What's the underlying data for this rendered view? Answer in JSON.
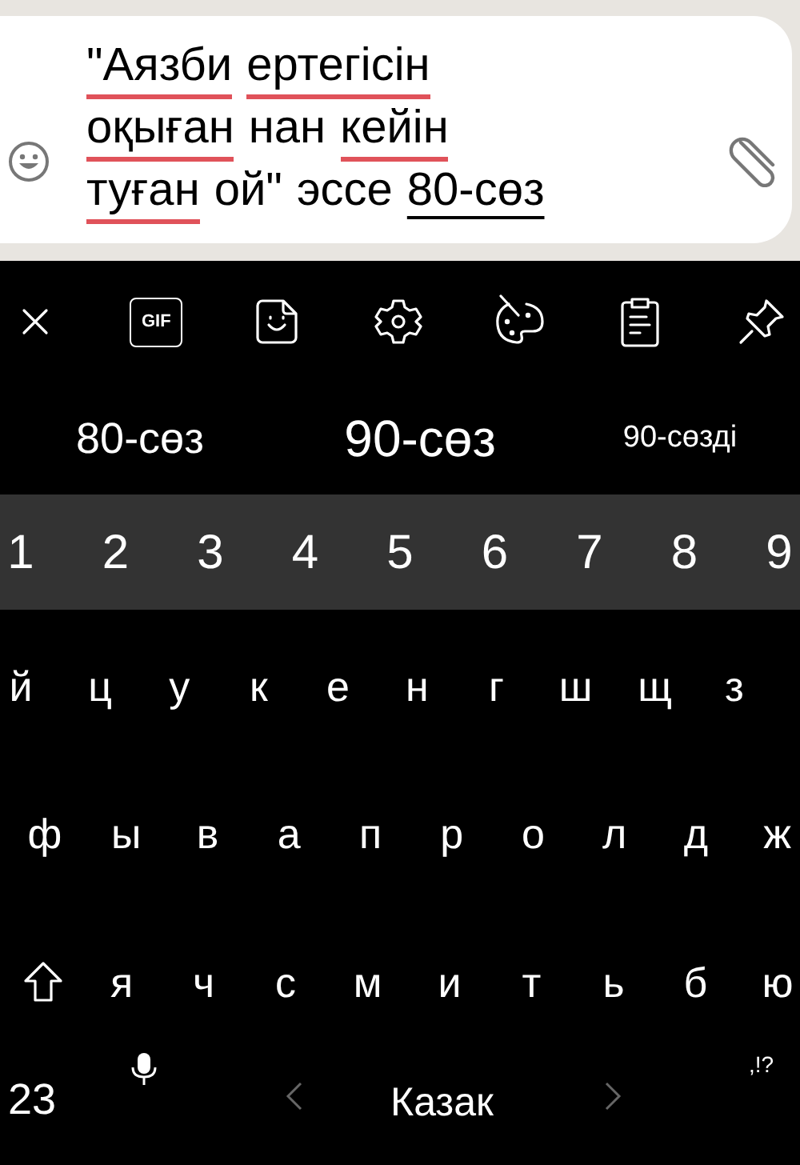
{
  "message": {
    "lines": [
      [
        {
          "text": "\"Аязби",
          "misspelled": true,
          "composing": false
        },
        {
          "text": "ертегісін",
          "misspelled": true,
          "composing": false
        }
      ],
      [
        {
          "text": "оқыған",
          "misspelled": true,
          "composing": false
        },
        {
          "text": "нан",
          "misspelled": false,
          "composing": false
        },
        {
          "text": "кейін",
          "misspelled": true,
          "composing": false
        }
      ],
      [
        {
          "text": "туған",
          "misspelled": true,
          "composing": false
        },
        {
          "text": "ой\"",
          "misspelled": false,
          "composing": false
        },
        {
          "text": "эссе",
          "misspelled": false,
          "composing": false
        },
        {
          "text": "80-сөз",
          "misspelled": false,
          "composing": true
        }
      ]
    ]
  },
  "toolbar": [
    {
      "kind": "close"
    },
    {
      "kind": "gif",
      "label": "GIF"
    },
    {
      "kind": "sticker"
    },
    {
      "kind": "settings"
    },
    {
      "kind": "palette"
    },
    {
      "kind": "clipboard"
    },
    {
      "kind": "pin"
    }
  ],
  "suggestions": [
    {
      "text": "80-сөз",
      "selected": false
    },
    {
      "text": "90-сөз",
      "selected": true
    },
    {
      "text": "90-сөзді",
      "selected": false
    }
  ],
  "number_row": [
    "1",
    "2",
    "3",
    "4",
    "5",
    "6",
    "7",
    "8",
    "9"
  ],
  "rows": [
    [
      "й",
      "ц",
      "у",
      "к",
      "е",
      "н",
      "г",
      "ш",
      "щ",
      "з"
    ],
    [
      "ф",
      "ы",
      "в",
      "а",
      "п",
      "р",
      "о",
      "л",
      "д",
      "ж"
    ],
    [
      "я",
      "ч",
      "с",
      "м",
      "и",
      "т",
      "ь",
      "б",
      "ю"
    ]
  ],
  "bottom_row": {
    "symbols_key": "23",
    "language": "Казак",
    "punctuation_key": ",!?"
  }
}
